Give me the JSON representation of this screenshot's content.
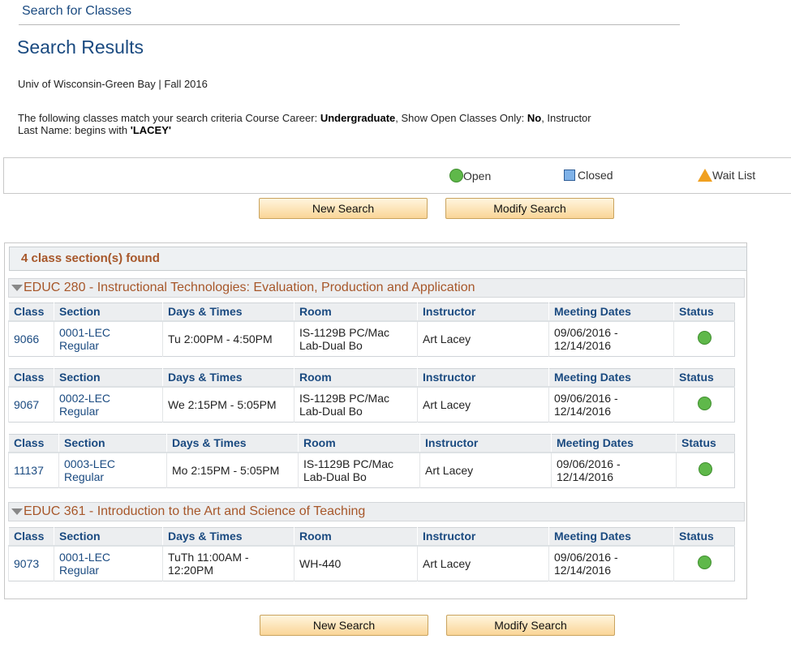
{
  "nav": {
    "title": "Search for Classes"
  },
  "page": {
    "title": "Search Results",
    "institution_term": "Univ of Wisconsin-Green Bay | Fall 2016",
    "criteria": {
      "intro": "The following classes match your search criteria Course Career: ",
      "career_value": "Undergraduate",
      "sep1": ",  Show Open Classes Only: ",
      "open_only_value": "No",
      "sep2": ",  Instructor Last Name: begins with ",
      "instructor_value": "'LACEY'"
    }
  },
  "legend": {
    "open": "Open",
    "closed": "Closed",
    "wait_list": "Wait List",
    "colors": {
      "open": "#5fb84a",
      "closed": "#7fb2e8",
      "wait_list": "#f0a020"
    }
  },
  "buttons": {
    "new_search": "New Search",
    "modify_search": "Modify Search"
  },
  "results": {
    "count_text": "4 class section(s) found",
    "columns": {
      "class": "Class",
      "section": "Section",
      "days_times": "Days & Times",
      "room": "Room",
      "instructor": "Instructor",
      "meeting_dates": "Meeting Dates",
      "status": "Status"
    },
    "courses": [
      {
        "title": "EDUC 280 - Instructional Technologies: Evaluation, Production and Application",
        "sections": [
          {
            "class": "9066",
            "section_1": "0001-LEC",
            "section_2": "Regular",
            "days_times": "Tu 2:00PM - 4:50PM",
            "room_1": "IS-1129B   PC/Mac",
            "room_2": "Lab-Dual Bo",
            "instructor": "Art Lacey",
            "dates_1": "09/06/2016 -",
            "dates_2": "12/14/2016",
            "status": "Open"
          },
          {
            "class": "9067",
            "section_1": "0002-LEC",
            "section_2": "Regular",
            "days_times": "We 2:15PM - 5:05PM",
            "room_1": "IS-1129B   PC/Mac",
            "room_2": "Lab-Dual Bo",
            "instructor": "Art Lacey",
            "dates_1": "09/06/2016 -",
            "dates_2": "12/14/2016",
            "status": "Open"
          },
          {
            "class": "11137",
            "section_1": "0003-LEC",
            "section_2": "Regular",
            "days_times": "Mo 2:15PM - 5:05PM",
            "room_1": "IS-1129B   PC/Mac",
            "room_2": "Lab-Dual Bo",
            "instructor": "Art Lacey",
            "dates_1": "09/06/2016 -",
            "dates_2": "12/14/2016",
            "status": "Open"
          }
        ]
      },
      {
        "title": "EDUC 361 - Introduction to the Art and Science of Teaching",
        "sections": [
          {
            "class": "9073",
            "section_1": "0001-LEC",
            "section_2": "Regular",
            "days_times_1": "TuTh 11:00AM -",
            "days_times_2": "12:20PM",
            "room": "WH-440",
            "instructor": "Art Lacey",
            "dates_1": "09/06/2016 -",
            "dates_2": "12/14/2016",
            "status": "Open"
          }
        ]
      }
    ]
  }
}
